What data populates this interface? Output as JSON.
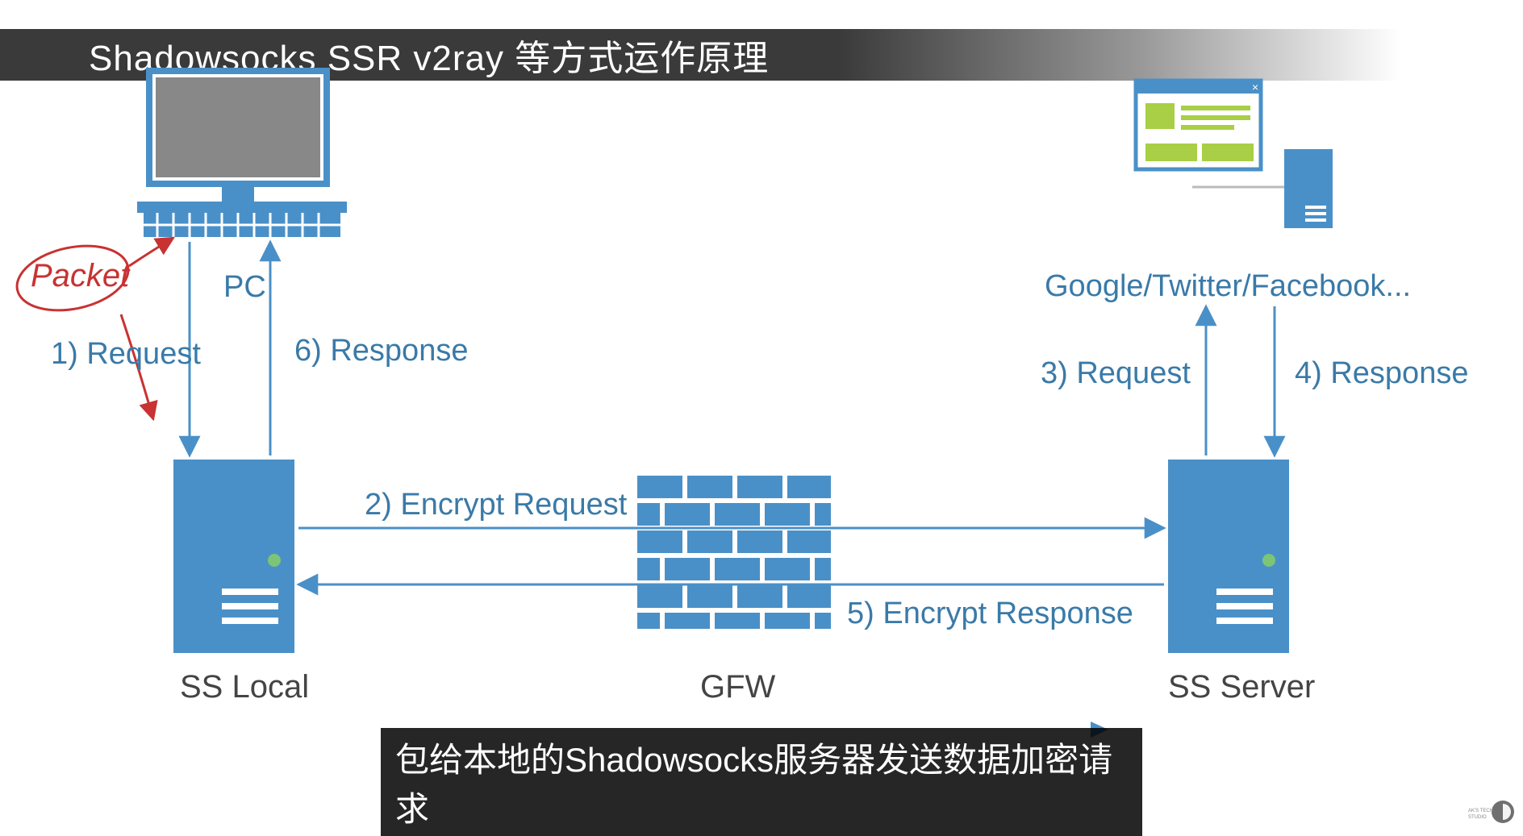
{
  "title": "Shadowsocks SSR v2ray 等方式运作原理",
  "nodes": {
    "pc": "PC",
    "ss_local": "SS Local",
    "gfw": "GFW",
    "ss_server": "SS Server",
    "services": "Google/Twitter/Facebook..."
  },
  "flows": {
    "step1": "1) Request",
    "step2": "2) Encrypt Request",
    "step3": "3) Request",
    "step4": "4) Response",
    "step5": "5) Encrypt Response",
    "step6": "6) Response"
  },
  "annotation": "Packet",
  "subtitle": "包给本地的Shadowsocks服务器发送数据加密请求",
  "watermark": "AK'S TECH STUDIO"
}
